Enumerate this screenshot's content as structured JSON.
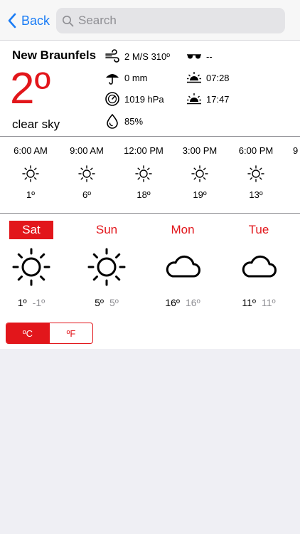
{
  "nav": {
    "back_label": "Back",
    "search_placeholder": "Search"
  },
  "current": {
    "city": "New Braunfels",
    "temperature": "2º",
    "condition": "clear sky",
    "wind": "2 M/S 310º",
    "visibility": "--",
    "precipitation": "0 mm",
    "sunrise": "07:28",
    "pressure": "1019 hPa",
    "sunset": "17:47",
    "humidity": "85%"
  },
  "hourly": [
    {
      "time": "6:00 AM",
      "icon": "sun-icon",
      "temp": "1º"
    },
    {
      "time": "9:00 AM",
      "icon": "sun-icon",
      "temp": "6º"
    },
    {
      "time": "12:00 PM",
      "icon": "sun-icon",
      "temp": "18º"
    },
    {
      "time": "3:00 PM",
      "icon": "sun-icon",
      "temp": "19º"
    },
    {
      "time": "6:00 PM",
      "icon": "sun-icon",
      "temp": "13º"
    },
    {
      "time": "9",
      "icon": "sun-icon",
      "temp": ""
    }
  ],
  "daily": [
    {
      "day": "Sat",
      "icon": "sun-icon",
      "high": "1º",
      "low": "-1º",
      "selected": true
    },
    {
      "day": "Sun",
      "icon": "sun-icon",
      "high": "5º",
      "low": "5º",
      "selected": false
    },
    {
      "day": "Mon",
      "icon": "cloud-icon",
      "high": "16º",
      "low": "16º",
      "selected": false
    },
    {
      "day": "Tue",
      "icon": "cloud-icon",
      "high": "11º",
      "low": "11º",
      "selected": false
    }
  ],
  "units": {
    "celsius": "ºC",
    "fahrenheit": "ºF",
    "selected": "celsius"
  },
  "colors": {
    "accent": "#e2161b",
    "link": "#1a7cf5"
  }
}
